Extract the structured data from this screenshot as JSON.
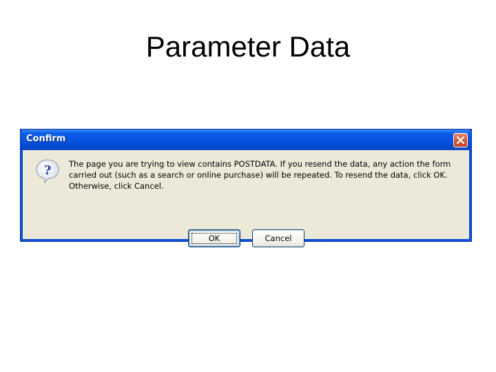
{
  "slide": {
    "title": "Parameter Data"
  },
  "dialog": {
    "title": "Confirm",
    "message_lines": [
      "The page you are trying to view contains POSTDATA. If you resend the data, any action the form",
      "carried out (such as a search or online purchase) will be repeated. To resend the data, click OK.",
      "Otherwise, click Cancel."
    ],
    "ok_label": "OK",
    "cancel_label": "Cancel",
    "icon": "question-icon",
    "close_icon": "close-icon"
  },
  "colors": {
    "titlebar": "#0553e0",
    "dialog_body": "#ece9d8",
    "close_button": "#d85c3b"
  }
}
